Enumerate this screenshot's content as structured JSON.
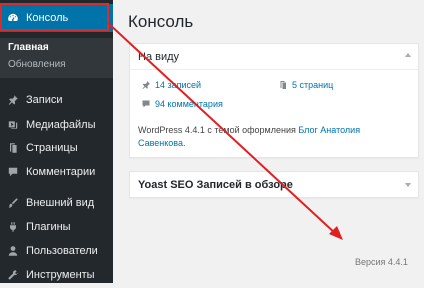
{
  "sidebar": {
    "items": [
      {
        "label": "Консоль",
        "icon": "dashboard-icon"
      },
      {
        "label": "Записи",
        "icon": "pushpin-icon"
      },
      {
        "label": "Медиафайлы",
        "icon": "media-icon"
      },
      {
        "label": "Страницы",
        "icon": "page-icon"
      },
      {
        "label": "Комментарии",
        "icon": "comment-icon"
      },
      {
        "label": "Внешний вид",
        "icon": "brush-icon"
      },
      {
        "label": "Плагины",
        "icon": "plugin-icon"
      },
      {
        "label": "Пользователи",
        "icon": "user-icon"
      },
      {
        "label": "Инструменты",
        "icon": "wrench-icon"
      }
    ],
    "submenu": {
      "home": "Главная",
      "updates": "Обновления"
    },
    "active_color": "#0073aa"
  },
  "main": {
    "title": "Консоль",
    "glance": {
      "title": "На виду",
      "posts": "14 записей",
      "pages": "5 страниц",
      "comments": "94 комментария",
      "theme_prefix": "WordPress 4.4.1 с темой оформления ",
      "theme_name": "Блог Анатолия Савенкова",
      "theme_suffix": "."
    },
    "yoast": {
      "title": "Yoast SEO Записей в обзоре"
    },
    "version": "Версия 4.4.1"
  },
  "annotation": {
    "color": "#e02020"
  }
}
